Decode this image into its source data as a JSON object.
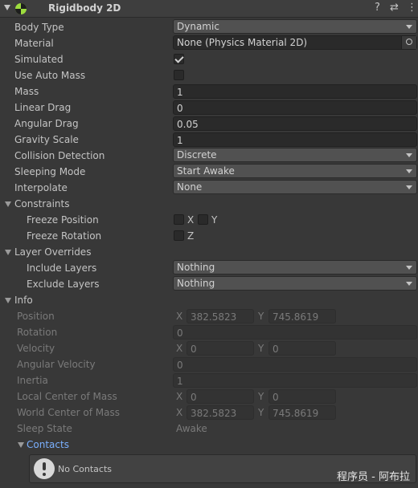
{
  "header": {
    "title": "Rigidbody 2D",
    "help_glyph": "?",
    "preset_glyph": "⇄",
    "menu_glyph": "⋮",
    "icon_color": "#9ddc3e"
  },
  "props": {
    "body_type": {
      "label": "Body Type",
      "value": "Dynamic"
    },
    "material": {
      "label": "Material",
      "value": "None (Physics Material 2D)"
    },
    "simulated": {
      "label": "Simulated",
      "checked": true
    },
    "use_auto_mass": {
      "label": "Use Auto Mass",
      "checked": false
    },
    "mass": {
      "label": "Mass",
      "value": "1"
    },
    "linear_drag": {
      "label": "Linear Drag",
      "value": "0"
    },
    "angular_drag": {
      "label": "Angular Drag",
      "value": "0.05"
    },
    "gravity_scale": {
      "label": "Gravity Scale",
      "value": "1"
    },
    "collision_detection": {
      "label": "Collision Detection",
      "value": "Discrete"
    },
    "sleeping_mode": {
      "label": "Sleeping Mode",
      "value": "Start Awake"
    },
    "interpolate": {
      "label": "Interpolate",
      "value": "None"
    }
  },
  "constraints": {
    "label": "Constraints",
    "freeze_position": {
      "label": "Freeze Position",
      "x_label": "X",
      "y_label": "Y",
      "x": false,
      "y": false
    },
    "freeze_rotation": {
      "label": "Freeze Rotation",
      "z_label": "Z",
      "z": false
    }
  },
  "layer_overrides": {
    "label": "Layer Overrides",
    "include": {
      "label": "Include Layers",
      "value": "Nothing"
    },
    "exclude": {
      "label": "Exclude Layers",
      "value": "Nothing"
    }
  },
  "info": {
    "label": "Info",
    "x": "X",
    "y": "Y",
    "position": {
      "label": "Position",
      "x": "382.5823",
      "y": "745.8619"
    },
    "rotation": {
      "label": "Rotation",
      "value": "0"
    },
    "velocity": {
      "label": "Velocity",
      "x": "0",
      "y": "0"
    },
    "angular_velocity": {
      "label": "Angular Velocity",
      "value": "0"
    },
    "inertia": {
      "label": "Inertia",
      "value": "1"
    },
    "local_com": {
      "label": "Local Center of Mass",
      "x": "0",
      "y": "0"
    },
    "world_com": {
      "label": "World Center of Mass",
      "x": "382.5823",
      "y": "745.8619"
    },
    "sleep_state": {
      "label": "Sleep State",
      "value": "Awake"
    },
    "contacts": {
      "label": "Contacts",
      "message": "No Contacts"
    }
  },
  "watermark": "程序员 - 阿布拉"
}
